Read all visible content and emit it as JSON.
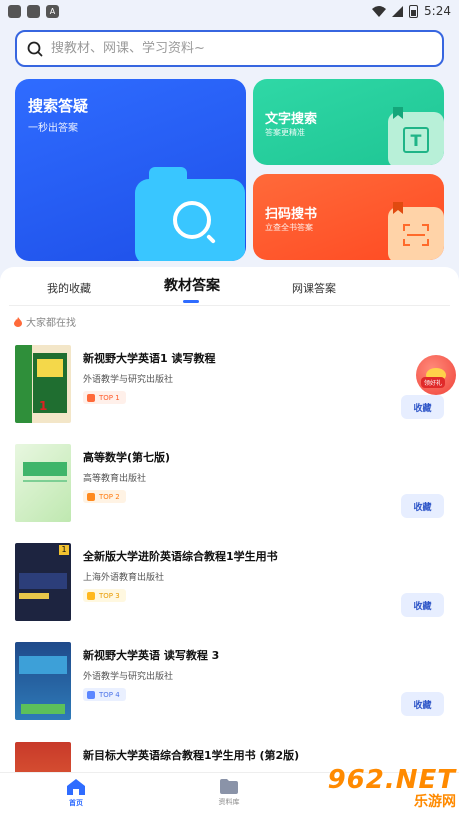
{
  "status_bar": {
    "time": "5:24",
    "icons": [
      "app-icon",
      "app-icon",
      "a-icon"
    ]
  },
  "search": {
    "placeholder": "搜教材、网课、学习资料~"
  },
  "cards": {
    "search_qa": {
      "title": "搜索答疑",
      "subtitle": "一秒出答案"
    },
    "text_search": {
      "title": "文字搜索",
      "subtitle": "答案更精准"
    },
    "scan_book": {
      "title": "扫码搜书",
      "subtitle": "立查全书答案"
    }
  },
  "tabs": [
    {
      "label": "我的收藏"
    },
    {
      "label": "教材答案"
    },
    {
      "label": "网课答案"
    }
  ],
  "hot_label": "大家都在找",
  "books": [
    {
      "name": "新视野大学英语1 读写教程",
      "publisher": "外语教学与研究出版社",
      "rank": "TOP 1",
      "collect": "收藏",
      "color": "#ff6a3a"
    },
    {
      "name": "高等数学(第七版)",
      "publisher": "高等教育出版社",
      "rank": "TOP 2",
      "collect": "收藏",
      "color": "#ff8a1e"
    },
    {
      "name": "全新版大学进阶英语综合教程1学生用书",
      "publisher": "上海外语教育出版社",
      "rank": "TOP 3",
      "collect": "收藏",
      "color": "#ffaa1e"
    },
    {
      "name": "新视野大学英语 读写教程 3",
      "publisher": "外语教学与研究出版社",
      "rank": "TOP 4",
      "collect": "收藏",
      "color": "#5b86ff"
    },
    {
      "name": "新目标大学英语综合教程1学生用书 (第2版)",
      "publisher": "",
      "rank": "",
      "collect": "",
      "color": "#5b86ff"
    }
  ],
  "float_badge": "领好礼",
  "nav": {
    "home": "首页",
    "library": "资料库"
  },
  "watermark": {
    "brand": "962.NET",
    "site": "乐游网"
  },
  "colors": {
    "accent": "#2f6cff",
    "green": "#1fc594",
    "orange": "#ff4a22"
  }
}
